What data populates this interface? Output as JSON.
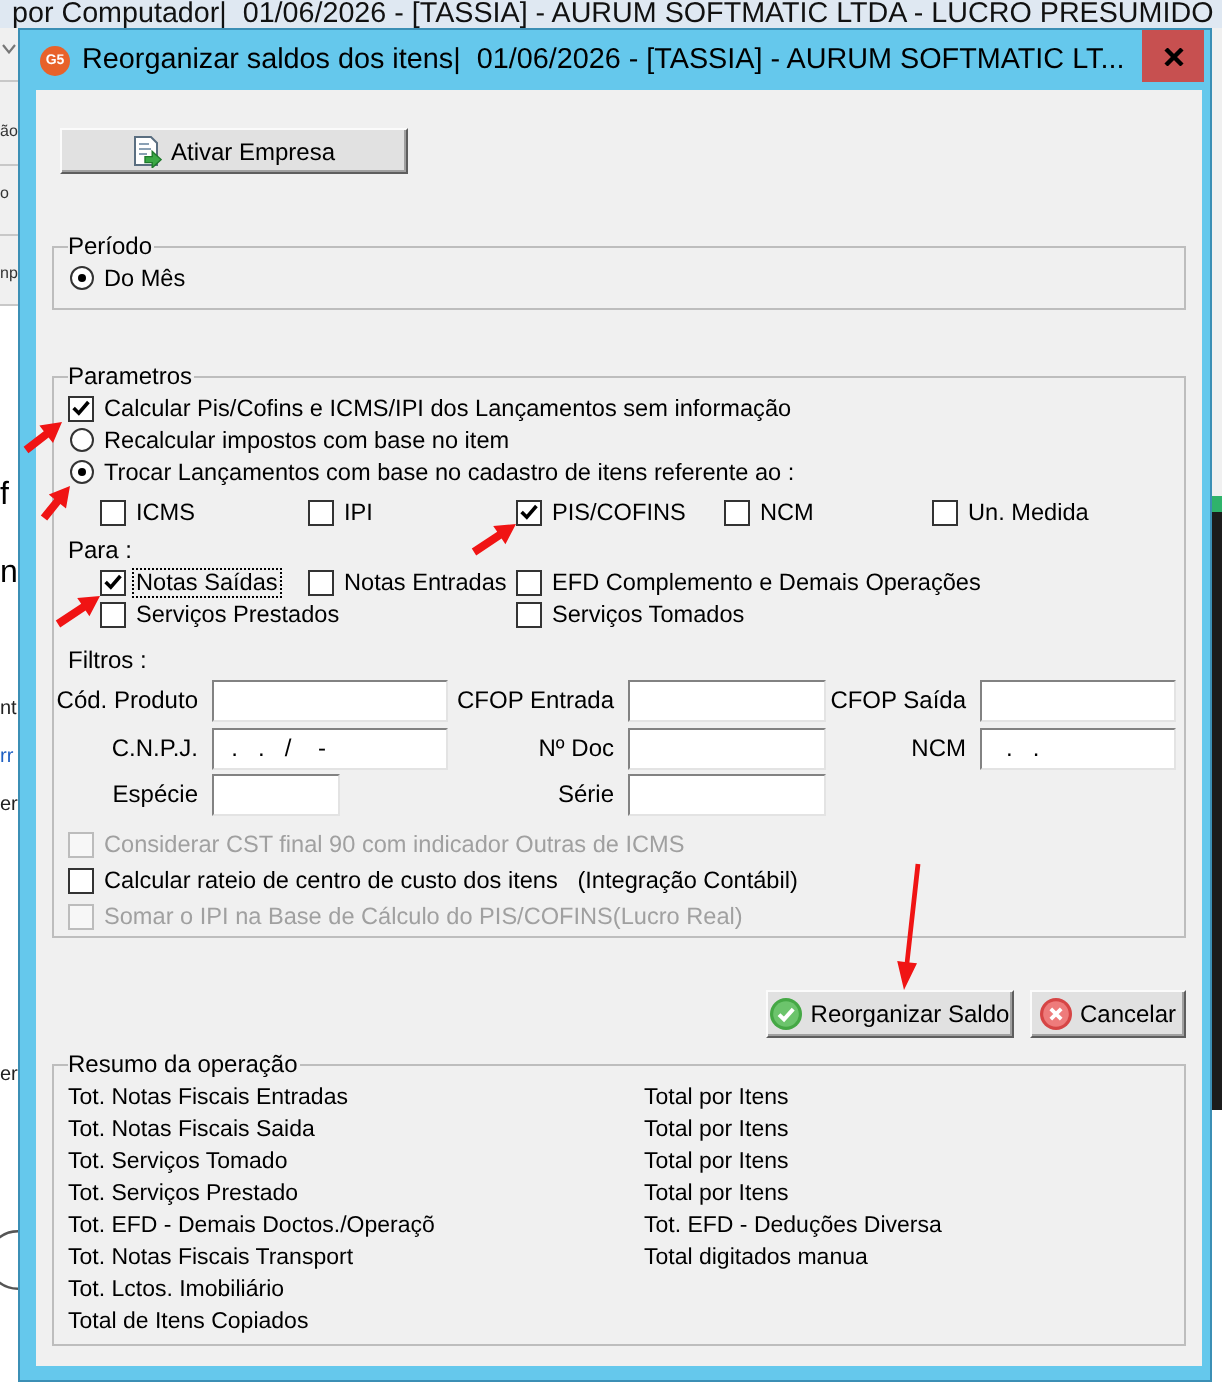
{
  "background_window": {
    "title": "por Computador|  01/06/2026 - [TASSIA] - AURUM SOFTMATIC LTDA - LUCRO PRESUMIDO",
    "fragments": [
      {
        "kind": "menu",
        "text": "ão"
      },
      {
        "kind": "menu",
        "text": "o"
      },
      {
        "kind": "menu",
        "text": "np"
      },
      {
        "kind": "large",
        "text": "f"
      },
      {
        "kind": "large",
        "text": "n"
      },
      {
        "kind": "body",
        "text": "nt"
      },
      {
        "kind": "link",
        "text": "rr"
      },
      {
        "kind": "body",
        "text": "er"
      },
      {
        "kind": "body",
        "text": "er"
      }
    ]
  },
  "dialog": {
    "logo": "G5",
    "title": "Reorganizar saldos dos itens|  01/06/2026 - [TASSIA] - AURUM SOFTMATIC LT...",
    "activate_button": {
      "label": "Ativar Empresa"
    },
    "periodo": {
      "title": "Período",
      "options": [
        {
          "label": "Do Mês",
          "selected": true
        }
      ]
    },
    "parametros": {
      "title": "Parametros",
      "options": [
        {
          "kind": "checkbox",
          "label": "Calcular Pis/Cofins e ICMS/IPI dos Lançamentos sem informação",
          "checked": true
        },
        {
          "kind": "radio",
          "label": "Recalcular impostos com base no item",
          "selected": false
        },
        {
          "kind": "radio",
          "label": "Trocar Lançamentos com base no cadastro de itens referente ao :",
          "selected": true
        }
      ],
      "replace_fields": [
        {
          "label": "ICMS",
          "checked": false
        },
        {
          "label": "IPI",
          "checked": false
        },
        {
          "label": "PIS/COFINS",
          "checked": true
        },
        {
          "label": "NCM",
          "checked": false
        },
        {
          "label": "Un. Medida",
          "checked": false
        }
      ],
      "para": {
        "label": "Para :",
        "columns": [
          [
            {
              "label": "Notas Saídas",
              "checked": true,
              "focused": true
            },
            {
              "label": "Serviços Prestados",
              "checked": false,
              "focused": false
            }
          ],
          [
            {
              "label": "Notas Entradas",
              "checked": false,
              "focused": false
            }
          ],
          [
            {
              "label": "EFD Complemento e Demais Operações",
              "checked": false,
              "focused": false
            },
            {
              "label": "Serviços Tomados",
              "checked": false,
              "focused": false
            }
          ]
        ]
      },
      "filters": {
        "label": "Filtros :",
        "fields": [
          {
            "label": "Cód. Produto"
          },
          {
            "label": "CFOP Entrada"
          },
          {
            "label": "CFOP Saída"
          },
          {
            "label": "C.N.P.J.",
            "value": "  .   .   /    -"
          },
          {
            "label": "Nº Doc"
          },
          {
            "label": "NCM",
            "value": "   .   ."
          },
          {
            "label": "Espécie"
          },
          {
            "label": "Série"
          }
        ]
      },
      "extra_options": [
        {
          "label": "Considerar CST final 90 com indicador Outras de ICMS",
          "checked": false,
          "disabled": true
        },
        {
          "label": "Calcular rateio de centro de custo dos itens   (Integração Contábil)",
          "checked": false,
          "disabled": false
        },
        {
          "label": "Somar o IPI na Base de Cálculo do PIS/COFINS(Lucro Real)",
          "checked": false,
          "disabled": true
        }
      ]
    },
    "buttons": [
      {
        "kind": "confirm",
        "label": "Reorganizar Saldo"
      },
      {
        "kind": "cancel",
        "label": "Cancelar"
      }
    ],
    "summary": {
      "title": "Resumo da operação",
      "column_1": [
        "Tot. Notas Fiscais Entradas",
        "Tot. Notas Fiscais Saida",
        "Tot. Serviços Tomado",
        "Tot. Serviços Prestado",
        "Tot. EFD - Demais Doctos./Operaçõ",
        "Tot. Notas Fiscais Transport",
        "Tot. Lctos. Imobiliário",
        "Total de Itens Copiados"
      ],
      "column_2": [
        "Total por Itens",
        "Total por Itens",
        "Total por Itens",
        "Total por Itens",
        "Tot. EFD - Deduções Diversa",
        "Total digitados manua"
      ]
    }
  }
}
